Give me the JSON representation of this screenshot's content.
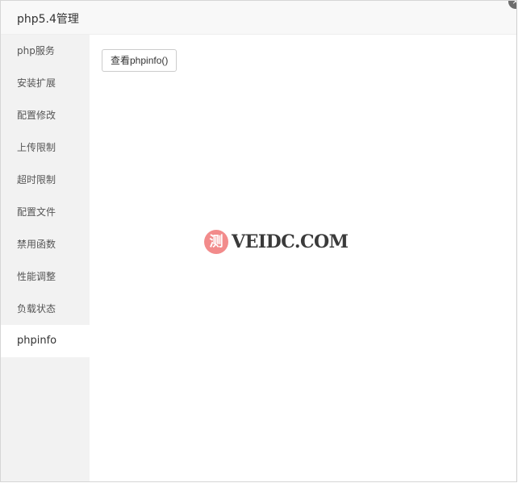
{
  "dialog": {
    "title": "php5.4管理",
    "close_icon": "×"
  },
  "sidebar": {
    "items": [
      {
        "label": "php服务",
        "active": false
      },
      {
        "label": "安装扩展",
        "active": false
      },
      {
        "label": "配置修改",
        "active": false
      },
      {
        "label": "上传限制",
        "active": false
      },
      {
        "label": "超时限制",
        "active": false
      },
      {
        "label": "配置文件",
        "active": false
      },
      {
        "label": "禁用函数",
        "active": false
      },
      {
        "label": "性能调整",
        "active": false
      },
      {
        "label": "负载状态",
        "active": false
      },
      {
        "label": "phpinfo",
        "active": true
      }
    ]
  },
  "content": {
    "view_phpinfo_button": "查看phpinfo()"
  },
  "watermark": {
    "badge": "测",
    "text": "VEIDC.COM",
    "badge_color": "#f28b8b"
  }
}
